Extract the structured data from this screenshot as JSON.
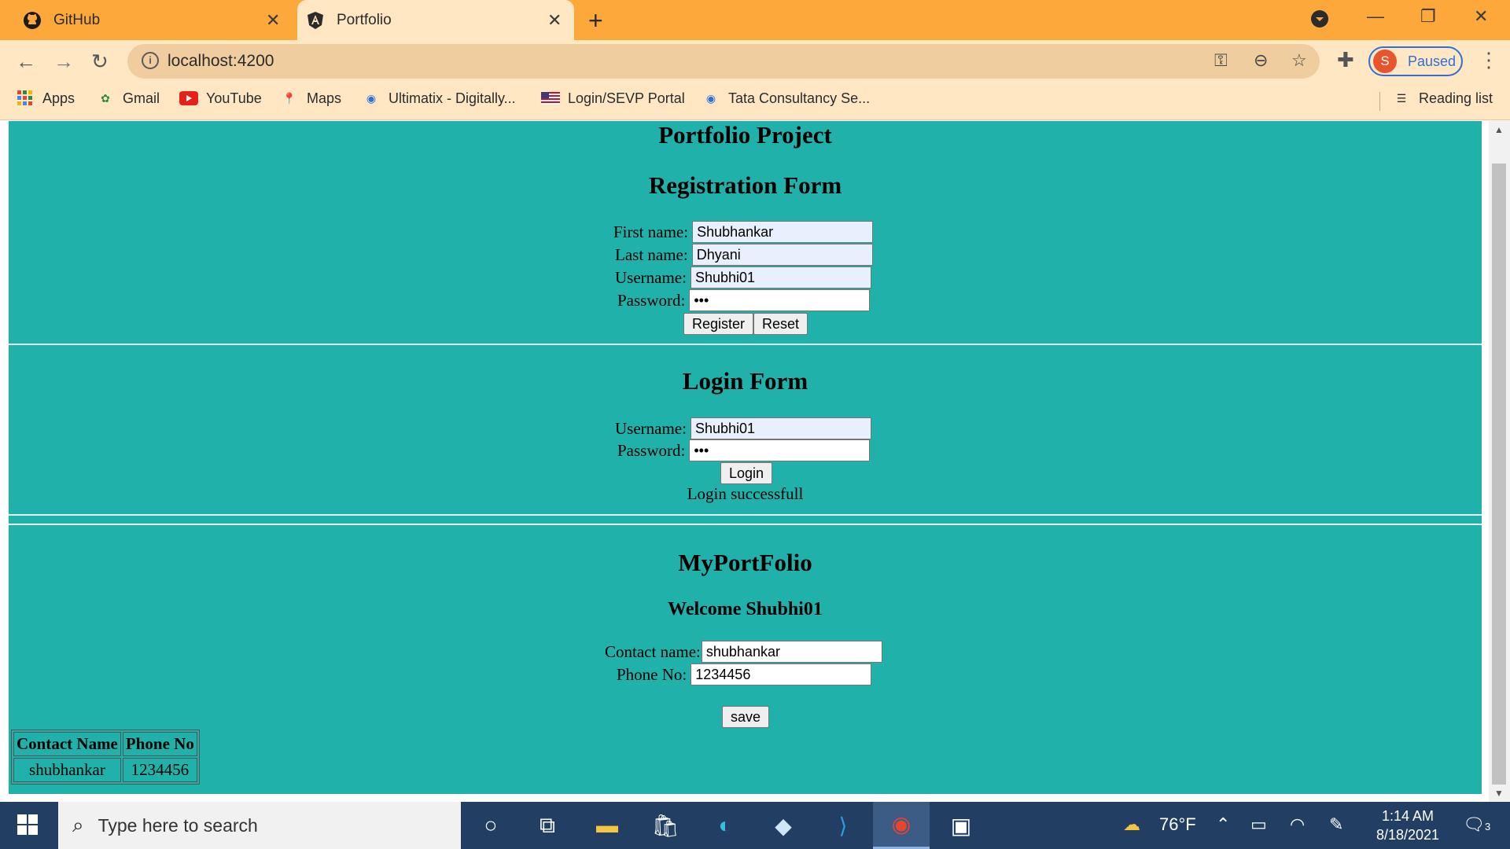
{
  "browser": {
    "tabs": [
      {
        "label": "GitHub",
        "icon": "github-icon"
      },
      {
        "label": "Portfolio",
        "icon": "angular-icon"
      }
    ],
    "url": "localhost:4200",
    "profile": {
      "initial": "S",
      "status": "Paused"
    },
    "bookmarks": [
      "Apps",
      "Gmail",
      "YouTube",
      "Maps",
      "Ultimatix - Digitally...",
      "Login/SEVP Portal",
      "Tata Consultancy Se..."
    ],
    "reading_list": "Reading list",
    "colors": {
      "tab_strip": "#fda83a",
      "toolbar": "#ffe7c4",
      "accent": "#2e6fd8"
    }
  },
  "page": {
    "title": "Portfolio Project",
    "background": "#20b2aa",
    "registration": {
      "heading": "Registration Form",
      "first_name_label": "First name:",
      "first_name_value": "Shubhankar",
      "last_name_label": "Last name:",
      "last_name_value": "Dhyani",
      "username_label": "Username:",
      "username_value": "Shubhi01",
      "password_label": "Password:",
      "password_value": "•••",
      "register_button": "Register",
      "reset_button": "Reset"
    },
    "login": {
      "heading": "Login Form",
      "username_label": "Username:",
      "username_value": "Shubhi01",
      "password_label": "Password:",
      "password_value": "•••",
      "login_button": "Login",
      "message": "Login successfull"
    },
    "portfolio": {
      "heading": "MyPortFolio",
      "welcome": "Welcome Shubhi01",
      "contact_name_label": "Contact name:",
      "contact_name_value": "shubhankar",
      "phone_label": "Phone No:",
      "phone_value": "1234456",
      "save_button": "save",
      "table": {
        "headers": [
          "Contact Name",
          "Phone No"
        ],
        "rows": [
          [
            "shubhankar",
            "1234456"
          ]
        ]
      }
    }
  },
  "taskbar": {
    "search_placeholder": "Type here to search",
    "weather": "76°F",
    "time": "1:14 AM",
    "date": "8/18/2021",
    "notifications": "3"
  }
}
